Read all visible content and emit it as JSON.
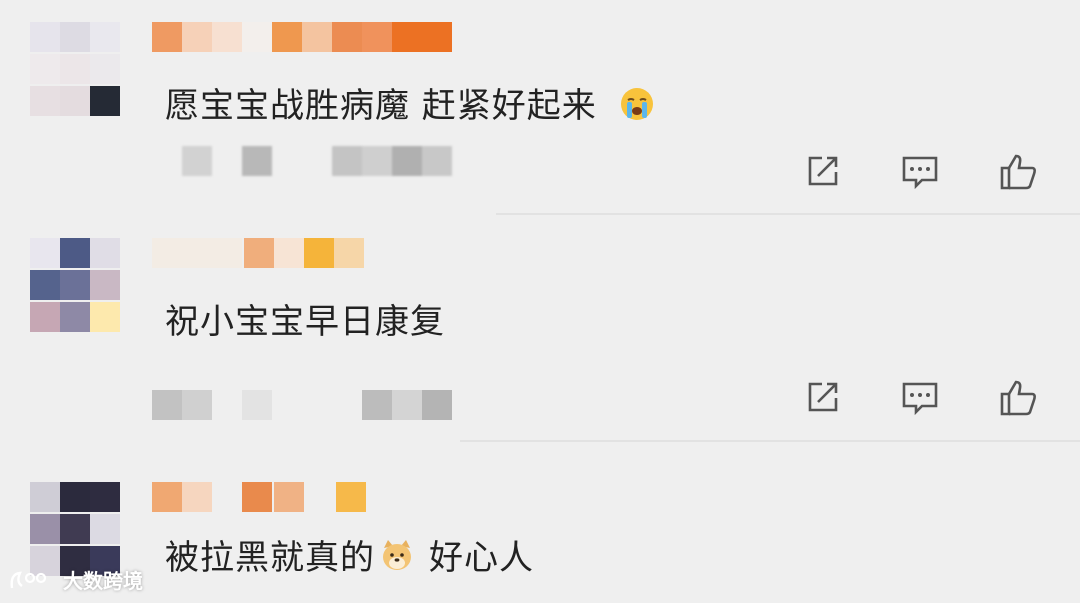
{
  "comments": [
    {
      "text": "愿宝宝战胜病魔 赶紧好起来",
      "emoji": "crying-face-icon",
      "username_redacted": true,
      "actions": [
        "share-icon",
        "reply-icon",
        "like-icon"
      ]
    },
    {
      "text": "祝小宝宝早日康复",
      "username_redacted": true,
      "actions": [
        "share-icon",
        "reply-icon",
        "like-icon"
      ]
    },
    {
      "text": "被拉黑就真的",
      "emoji": "doge-dog-icon",
      "text_after": "好心人",
      "username_redacted": true
    }
  ],
  "watermark": {
    "text": "大数跨境"
  },
  "colors": {
    "background": "#efefef",
    "text": "#222222",
    "icon": "#555555",
    "name_orange": "#ec7a2c"
  }
}
